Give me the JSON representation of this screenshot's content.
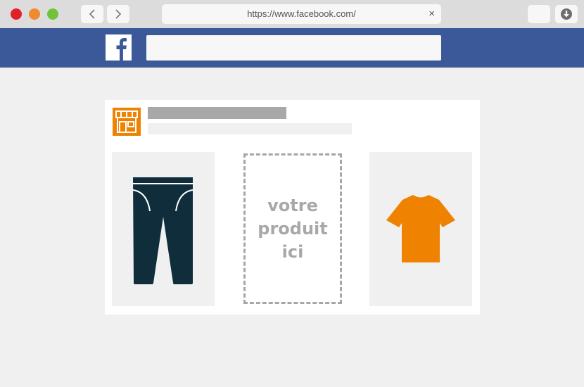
{
  "browser": {
    "url": "https://www.facebook.com/",
    "clear_icon": "×",
    "buttons": {
      "close": "red-close-dot",
      "minimize": "orange-minimize-dot",
      "maximize": "green-maximize-dot",
      "back": "chevron-left-icon",
      "forward": "chevron-right-icon",
      "download": "download-icon"
    }
  },
  "facebook": {
    "logo": "facebook-logo",
    "search": {
      "value": ""
    }
  },
  "ad_card": {
    "store_icon": "storefront-icon",
    "products": [
      {
        "name": "jeans",
        "icon": "jeans-icon"
      },
      {
        "name": "placeholder",
        "text": "votre produit ici"
      },
      {
        "name": "t-shirt",
        "icon": "tshirt-icon"
      }
    ]
  },
  "colors": {
    "facebook_blue": "#3b5998",
    "accent_orange": "#ef8200",
    "jeans_navy": "#0f2d3b",
    "background": "#f0f0f0"
  }
}
